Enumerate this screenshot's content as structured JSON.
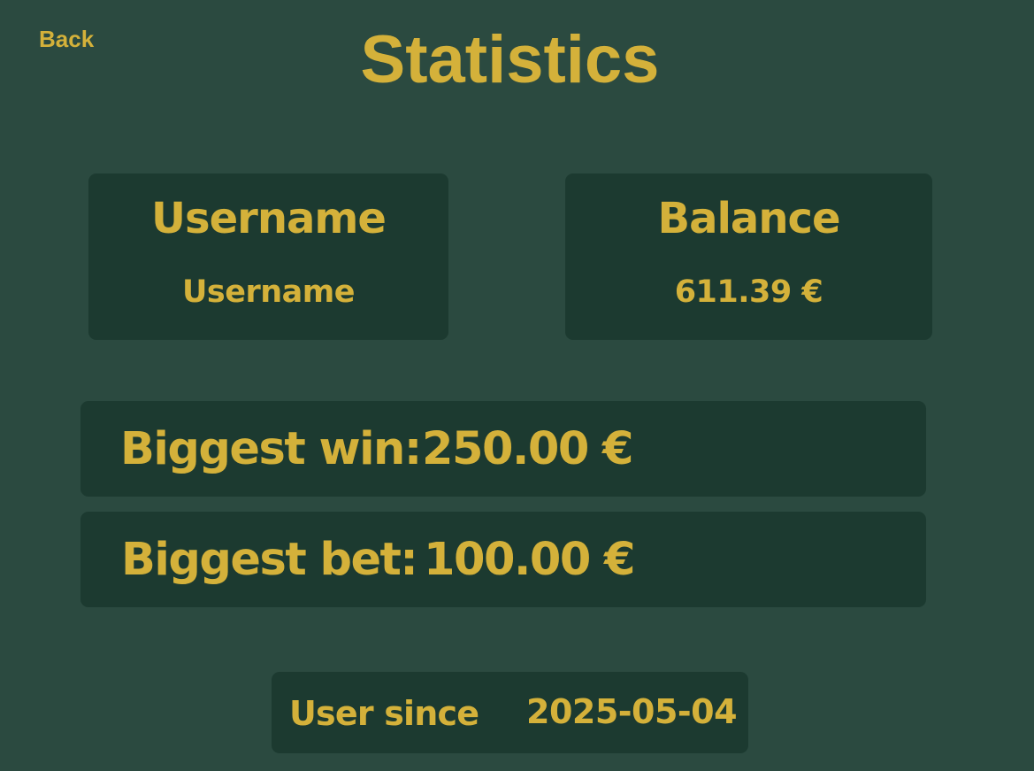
{
  "header": {
    "back_label": "Back",
    "title": "Statistics"
  },
  "cards": {
    "username": {
      "heading": "Username",
      "value": "Username"
    },
    "balance": {
      "heading": "Balance",
      "value": "611.39 €"
    }
  },
  "stats": {
    "biggest_win": {
      "label": "Biggest win:",
      "value": "250.00 €"
    },
    "biggest_bet": {
      "label": "Biggest bet:",
      "value": "100.00 €"
    }
  },
  "user_since": {
    "label": "User since",
    "value": "2025-05-04"
  },
  "colors": {
    "background": "#2b4a40",
    "card": "#1c3a30",
    "accent": "#d4b13a"
  }
}
